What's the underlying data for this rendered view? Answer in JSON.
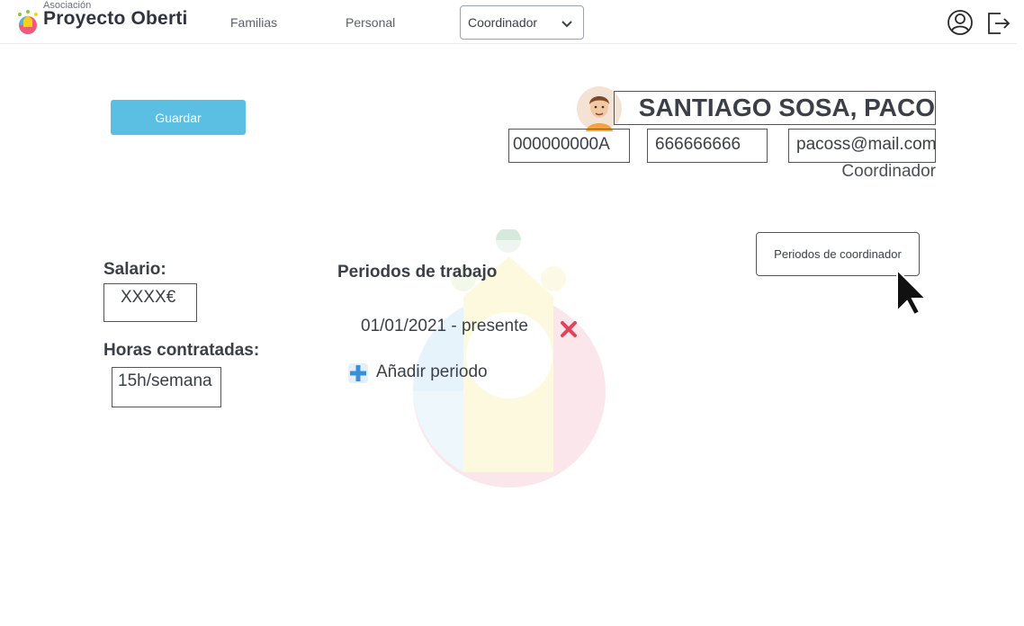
{
  "header": {
    "logo_small": "Asociación",
    "logo_big": "Proyecto Oberti",
    "nav": {
      "familias": "Familias",
      "personal": "Personal"
    },
    "role_select": {
      "value": "Coordinador"
    },
    "icons": {
      "profile": "user-circle-icon",
      "logout": "logout-icon"
    }
  },
  "actions": {
    "save_label": "Guardar"
  },
  "profile": {
    "name": "SANTIAGO SOSA, PACO",
    "dni": "000000000A",
    "phone": "666666666",
    "email": "pacoss@mail.com",
    "role": "Coordinador"
  },
  "periods_button": {
    "label": "Periodos de coordinador"
  },
  "salary": {
    "label": "Salario:",
    "value": "XXXX€"
  },
  "hours": {
    "label": "Horas contratadas:",
    "value": "15h/semana"
  },
  "work_periods": {
    "title": "Periodos de trabajo",
    "items": [
      {
        "range": "01/01/2021 - presente"
      }
    ],
    "add_label": "Añadir periodo"
  },
  "colors": {
    "accent": "#5bbfe3",
    "delete": "#e0445a",
    "add": "#3a8fd9"
  }
}
